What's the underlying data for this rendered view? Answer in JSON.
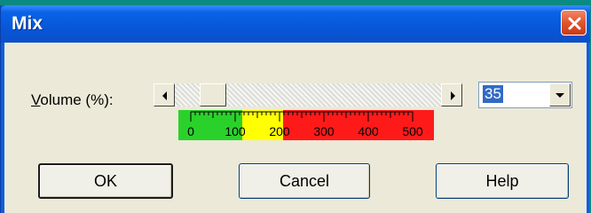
{
  "window": {
    "title": "Mix"
  },
  "volume": {
    "label_underlined_char": "V",
    "label_rest": "olume (%):",
    "value": "35",
    "slider_fraction": 0.07
  },
  "ruler": {
    "ticks": [
      "0",
      "100",
      "200",
      "300",
      "400",
      "500"
    ],
    "colors": {
      "green": "#2bd12b",
      "yellow": "#ffff00",
      "red": "#ff1a1a"
    }
  },
  "buttons": {
    "ok": "OK",
    "cancel": "Cancel",
    "help": "Help"
  },
  "icons": {
    "close": "close-icon",
    "scroll_left": "arrow-left-icon",
    "scroll_right": "arrow-right-icon",
    "dropdown": "chevron-down-icon"
  }
}
